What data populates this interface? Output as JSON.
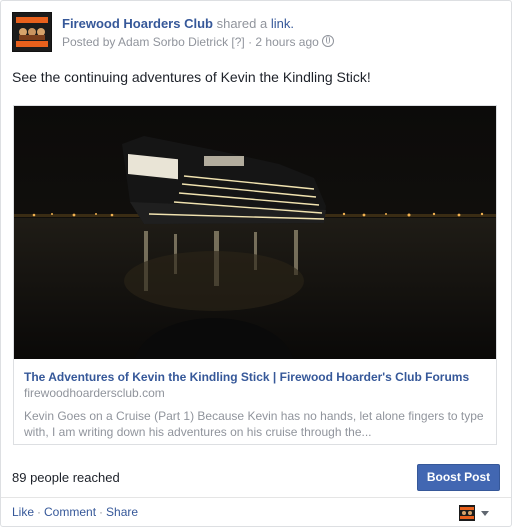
{
  "post": {
    "page_name": "Firewood Hoarders Club",
    "shared_text": "shared a",
    "shared_link": "link.",
    "posted_by": "Posted by Adam Sorbo Dietrick [?] · 2 hours ago",
    "message": "See the continuing adventures of Kevin the Kindling Stick!",
    "avatar_text": {
      "top": "THE FIREWOOD",
      "bottom": "HOARDERS CLUB"
    }
  },
  "link_preview": {
    "title": "The Adventures of Kevin the Kindling Stick | Firewood Hoarder's Club Forums",
    "domain": "firewoodhoardersclub.com",
    "description": "Kevin Goes on a Cruise (Part 1) Because Kevin has no hands, let alone fingers to type with, I am writing down his adventures on his cruise through the..."
  },
  "stats": {
    "reach": "89 people reached",
    "boost_label": "Boost Post"
  },
  "actions": {
    "like": "Like",
    "comment": "Comment",
    "share": "Share"
  }
}
